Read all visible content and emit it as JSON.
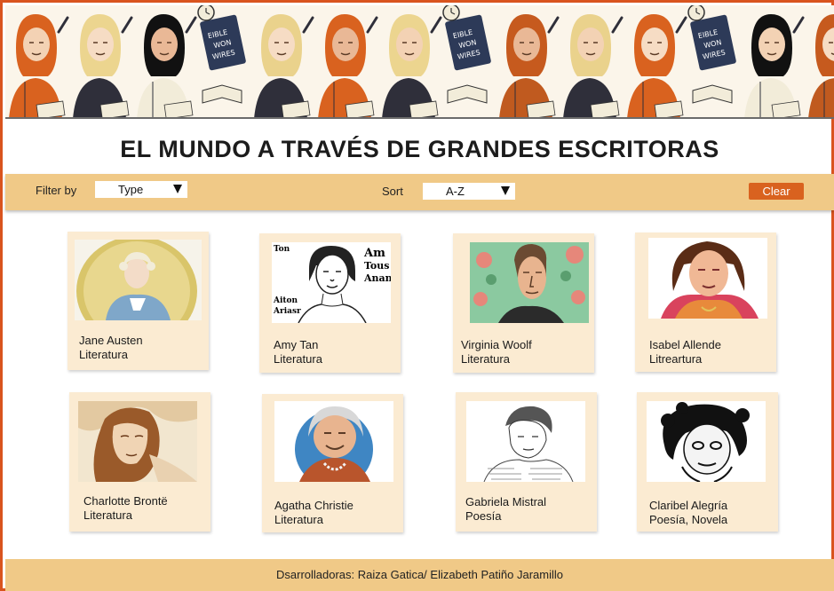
{
  "page_title": "EL MUNDO A TRAVÉS DE GRANDES ESCRITORAS",
  "banner": {
    "book_label_line1": "EIBLE",
    "book_label_line2": "WON",
    "book_label_line3": "WIRES"
  },
  "controls": {
    "filter_label": "Filter by",
    "filter_value": "Type",
    "sort_label": "Sort",
    "sort_value": "A-Z",
    "clear_label": "Clear"
  },
  "cards": [
    {
      "name": "Jane Austen",
      "genre": "Literatura"
    },
    {
      "name": "Amy Tan",
      "genre": "Literatura",
      "photo_text": [
        "Ton",
        "Am",
        "Tous",
        "Anan",
        "Aiton",
        "Ariasr"
      ]
    },
    {
      "name": "Virginia Woolf",
      "genre": "Literatura"
    },
    {
      "name": "Isabel Allende",
      "genre": "Litreartura"
    },
    {
      "name": "Charlotte Brontë",
      "genre": "Literatura"
    },
    {
      "name": "Agatha Christie",
      "genre": "Literatura"
    },
    {
      "name": "Gabriela Mistral",
      "genre": "Poesía"
    },
    {
      "name": "Claribel Alegría",
      "genre": "Poesía, Novela"
    }
  ],
  "footer": {
    "credits": "Dsarrolladoras: Raiza Gatica/ Elizabeth Patiño Jaramillo"
  },
  "colors": {
    "accent": "#d9621f",
    "bar": "#f0c987",
    "card": "#fbebd2",
    "border": "#d9541e"
  }
}
